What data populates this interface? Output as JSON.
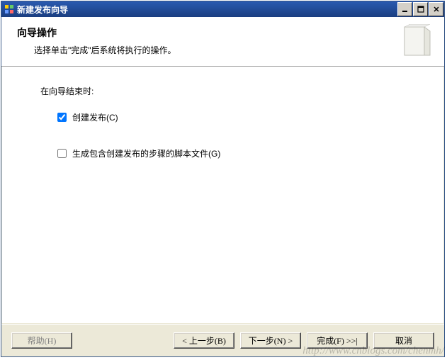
{
  "window": {
    "title": "新建发布向导"
  },
  "header": {
    "title": "向导操作",
    "subtitle": "选择单击\"完成\"后系统将执行的操作。"
  },
  "content": {
    "section_label": "在向导结束时:",
    "option_create": {
      "label": "创建发布(C)",
      "checked": true
    },
    "option_script": {
      "label": "生成包含创建发布的步骤的脚本文件(G)",
      "checked": false
    }
  },
  "footer": {
    "help": "帮助(H)",
    "back": "< 上一步(B)",
    "next": "下一步(N) >",
    "finish": "完成(F) >>|",
    "cancel": "取消"
  },
  "watermark": "http://www.cnblogs.com/chenmh/"
}
